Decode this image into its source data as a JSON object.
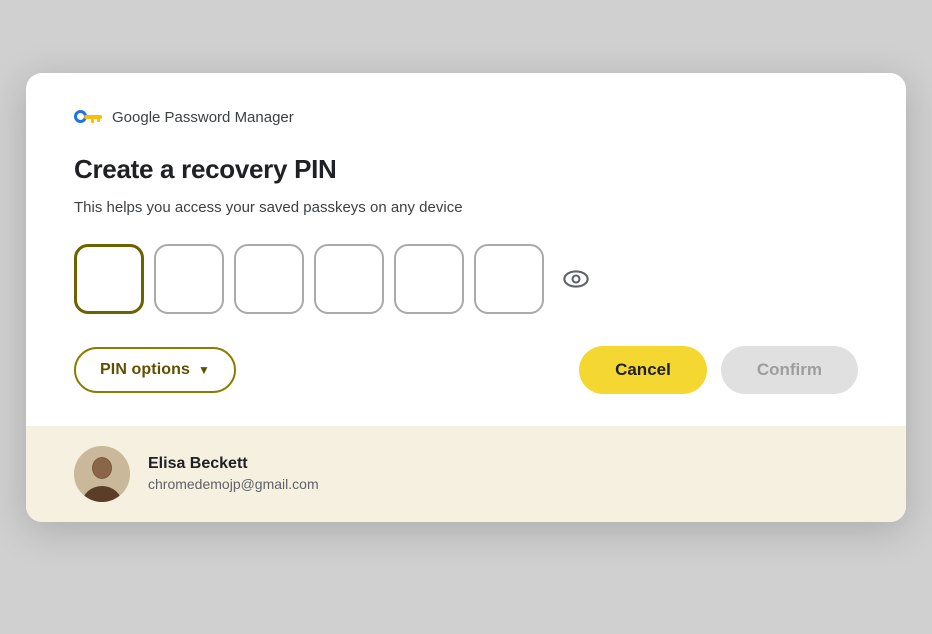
{
  "dialog": {
    "gpm_label": "Google Password Manager",
    "title": "Create a recovery PIN",
    "subtitle": "This helps you access your saved passkeys on any device",
    "pin_boxes": [
      "",
      "",
      "",
      "",
      "",
      ""
    ],
    "pin_options_label": "PIN options",
    "cancel_label": "Cancel",
    "confirm_label": "Confirm"
  },
  "footer": {
    "user_name": "Elisa Beckett",
    "user_email": "chromedemojp@gmail.com"
  },
  "colors": {
    "pin_border_active": "#6b6200",
    "pin_options_border": "#8a7c00",
    "cancel_bg": "#f5d732",
    "confirm_bg": "#e0e0e0",
    "footer_bg": "#f5f0e0"
  }
}
